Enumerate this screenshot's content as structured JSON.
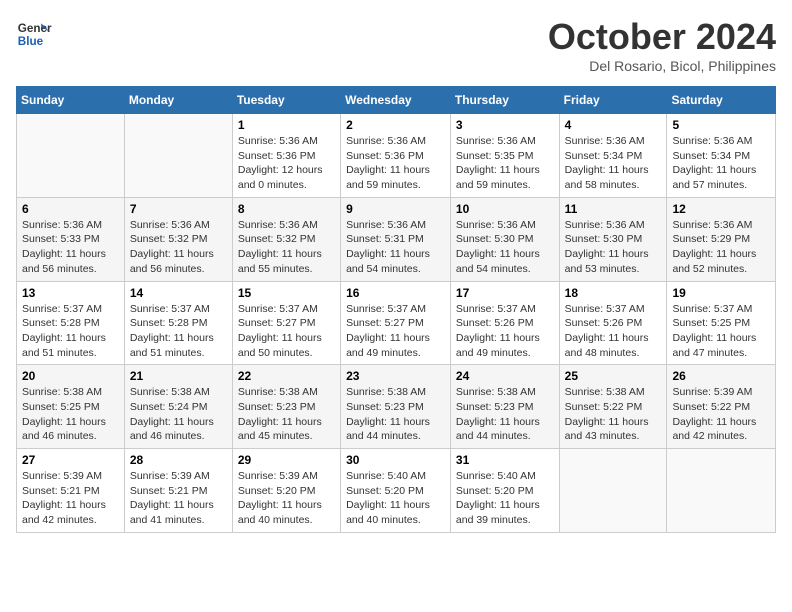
{
  "logo": {
    "line1": "General",
    "line2": "Blue"
  },
  "title": "October 2024",
  "subtitle": "Del Rosario, Bicol, Philippines",
  "days_header": [
    "Sunday",
    "Monday",
    "Tuesday",
    "Wednesday",
    "Thursday",
    "Friday",
    "Saturday"
  ],
  "weeks": [
    [
      {
        "day": "",
        "sunrise": "",
        "sunset": "",
        "daylight": ""
      },
      {
        "day": "",
        "sunrise": "",
        "sunset": "",
        "daylight": ""
      },
      {
        "day": "1",
        "sunrise": "Sunrise: 5:36 AM",
        "sunset": "Sunset: 5:36 PM",
        "daylight": "Daylight: 12 hours and 0 minutes."
      },
      {
        "day": "2",
        "sunrise": "Sunrise: 5:36 AM",
        "sunset": "Sunset: 5:36 PM",
        "daylight": "Daylight: 11 hours and 59 minutes."
      },
      {
        "day": "3",
        "sunrise": "Sunrise: 5:36 AM",
        "sunset": "Sunset: 5:35 PM",
        "daylight": "Daylight: 11 hours and 59 minutes."
      },
      {
        "day": "4",
        "sunrise": "Sunrise: 5:36 AM",
        "sunset": "Sunset: 5:34 PM",
        "daylight": "Daylight: 11 hours and 58 minutes."
      },
      {
        "day": "5",
        "sunrise": "Sunrise: 5:36 AM",
        "sunset": "Sunset: 5:34 PM",
        "daylight": "Daylight: 11 hours and 57 minutes."
      }
    ],
    [
      {
        "day": "6",
        "sunrise": "Sunrise: 5:36 AM",
        "sunset": "Sunset: 5:33 PM",
        "daylight": "Daylight: 11 hours and 56 minutes."
      },
      {
        "day": "7",
        "sunrise": "Sunrise: 5:36 AM",
        "sunset": "Sunset: 5:32 PM",
        "daylight": "Daylight: 11 hours and 56 minutes."
      },
      {
        "day": "8",
        "sunrise": "Sunrise: 5:36 AM",
        "sunset": "Sunset: 5:32 PM",
        "daylight": "Daylight: 11 hours and 55 minutes."
      },
      {
        "day": "9",
        "sunrise": "Sunrise: 5:36 AM",
        "sunset": "Sunset: 5:31 PM",
        "daylight": "Daylight: 11 hours and 54 minutes."
      },
      {
        "day": "10",
        "sunrise": "Sunrise: 5:36 AM",
        "sunset": "Sunset: 5:30 PM",
        "daylight": "Daylight: 11 hours and 54 minutes."
      },
      {
        "day": "11",
        "sunrise": "Sunrise: 5:36 AM",
        "sunset": "Sunset: 5:30 PM",
        "daylight": "Daylight: 11 hours and 53 minutes."
      },
      {
        "day": "12",
        "sunrise": "Sunrise: 5:36 AM",
        "sunset": "Sunset: 5:29 PM",
        "daylight": "Daylight: 11 hours and 52 minutes."
      }
    ],
    [
      {
        "day": "13",
        "sunrise": "Sunrise: 5:37 AM",
        "sunset": "Sunset: 5:28 PM",
        "daylight": "Daylight: 11 hours and 51 minutes."
      },
      {
        "day": "14",
        "sunrise": "Sunrise: 5:37 AM",
        "sunset": "Sunset: 5:28 PM",
        "daylight": "Daylight: 11 hours and 51 minutes."
      },
      {
        "day": "15",
        "sunrise": "Sunrise: 5:37 AM",
        "sunset": "Sunset: 5:27 PM",
        "daylight": "Daylight: 11 hours and 50 minutes."
      },
      {
        "day": "16",
        "sunrise": "Sunrise: 5:37 AM",
        "sunset": "Sunset: 5:27 PM",
        "daylight": "Daylight: 11 hours and 49 minutes."
      },
      {
        "day": "17",
        "sunrise": "Sunrise: 5:37 AM",
        "sunset": "Sunset: 5:26 PM",
        "daylight": "Daylight: 11 hours and 49 minutes."
      },
      {
        "day": "18",
        "sunrise": "Sunrise: 5:37 AM",
        "sunset": "Sunset: 5:26 PM",
        "daylight": "Daylight: 11 hours and 48 minutes."
      },
      {
        "day": "19",
        "sunrise": "Sunrise: 5:37 AM",
        "sunset": "Sunset: 5:25 PM",
        "daylight": "Daylight: 11 hours and 47 minutes."
      }
    ],
    [
      {
        "day": "20",
        "sunrise": "Sunrise: 5:38 AM",
        "sunset": "Sunset: 5:25 PM",
        "daylight": "Daylight: 11 hours and 46 minutes."
      },
      {
        "day": "21",
        "sunrise": "Sunrise: 5:38 AM",
        "sunset": "Sunset: 5:24 PM",
        "daylight": "Daylight: 11 hours and 46 minutes."
      },
      {
        "day": "22",
        "sunrise": "Sunrise: 5:38 AM",
        "sunset": "Sunset: 5:23 PM",
        "daylight": "Daylight: 11 hours and 45 minutes."
      },
      {
        "day": "23",
        "sunrise": "Sunrise: 5:38 AM",
        "sunset": "Sunset: 5:23 PM",
        "daylight": "Daylight: 11 hours and 44 minutes."
      },
      {
        "day": "24",
        "sunrise": "Sunrise: 5:38 AM",
        "sunset": "Sunset: 5:23 PM",
        "daylight": "Daylight: 11 hours and 44 minutes."
      },
      {
        "day": "25",
        "sunrise": "Sunrise: 5:38 AM",
        "sunset": "Sunset: 5:22 PM",
        "daylight": "Daylight: 11 hours and 43 minutes."
      },
      {
        "day": "26",
        "sunrise": "Sunrise: 5:39 AM",
        "sunset": "Sunset: 5:22 PM",
        "daylight": "Daylight: 11 hours and 42 minutes."
      }
    ],
    [
      {
        "day": "27",
        "sunrise": "Sunrise: 5:39 AM",
        "sunset": "Sunset: 5:21 PM",
        "daylight": "Daylight: 11 hours and 42 minutes."
      },
      {
        "day": "28",
        "sunrise": "Sunrise: 5:39 AM",
        "sunset": "Sunset: 5:21 PM",
        "daylight": "Daylight: 11 hours and 41 minutes."
      },
      {
        "day": "29",
        "sunrise": "Sunrise: 5:39 AM",
        "sunset": "Sunset: 5:20 PM",
        "daylight": "Daylight: 11 hours and 40 minutes."
      },
      {
        "day": "30",
        "sunrise": "Sunrise: 5:40 AM",
        "sunset": "Sunset: 5:20 PM",
        "daylight": "Daylight: 11 hours and 40 minutes."
      },
      {
        "day": "31",
        "sunrise": "Sunrise: 5:40 AM",
        "sunset": "Sunset: 5:20 PM",
        "daylight": "Daylight: 11 hours and 39 minutes."
      },
      {
        "day": "",
        "sunrise": "",
        "sunset": "",
        "daylight": ""
      },
      {
        "day": "",
        "sunrise": "",
        "sunset": "",
        "daylight": ""
      }
    ]
  ]
}
